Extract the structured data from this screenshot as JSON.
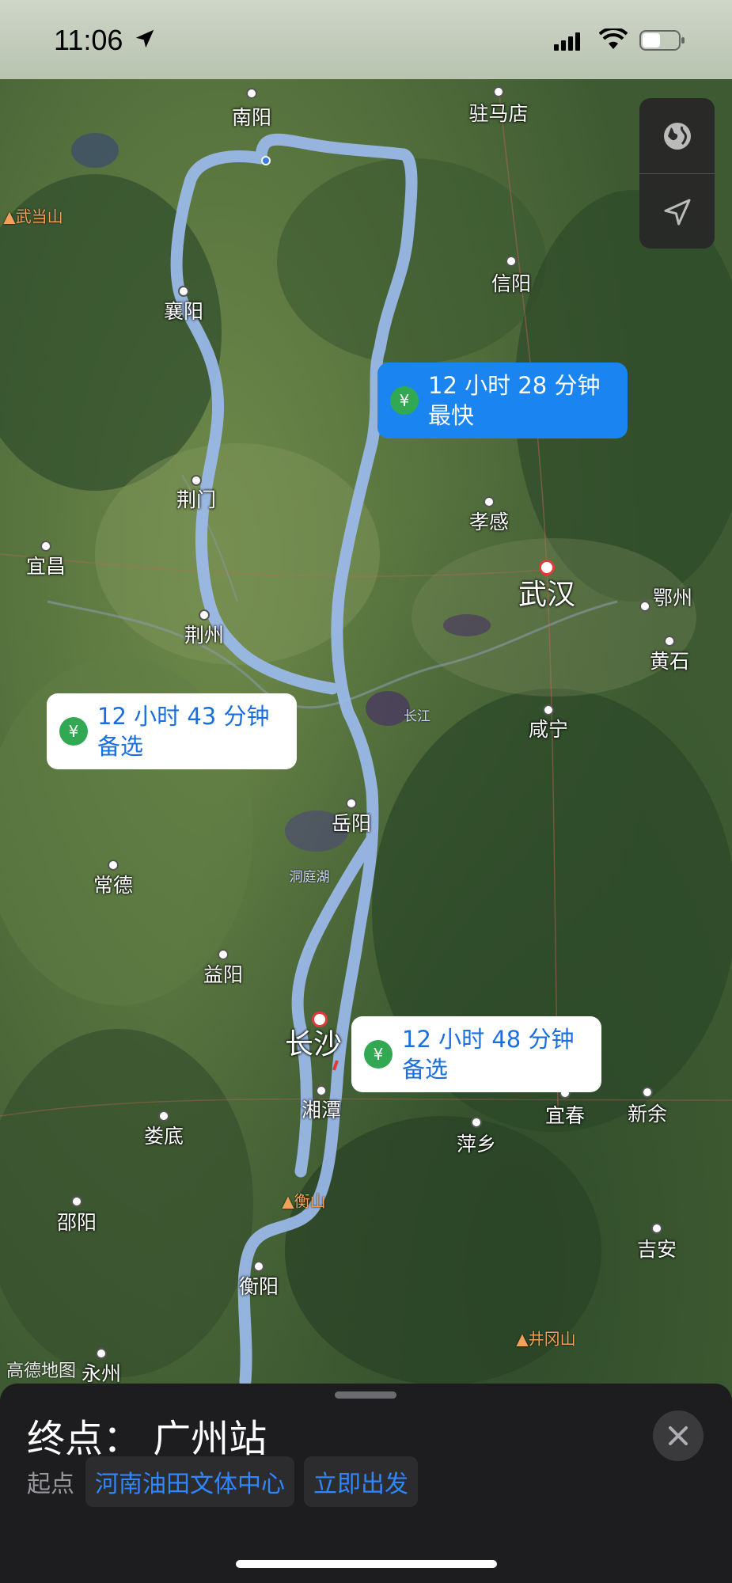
{
  "status_bar": {
    "time": "11:06"
  },
  "map": {
    "cities": [
      {
        "name": "南阳",
        "style": "normal"
      },
      {
        "name": "驻马店",
        "style": "normal"
      },
      {
        "name": "武当山",
        "style": "orange"
      },
      {
        "name": "信阳",
        "style": "normal"
      },
      {
        "name": "襄阳",
        "style": "normal"
      },
      {
        "name": "荆门",
        "style": "normal"
      },
      {
        "name": "孝感",
        "style": "normal"
      },
      {
        "name": "宜昌",
        "style": "normal"
      },
      {
        "name": "武汉",
        "style": "big"
      },
      {
        "name": "鄂州",
        "style": "normal"
      },
      {
        "name": "荆州",
        "style": "normal"
      },
      {
        "name": "黄石",
        "style": "normal"
      },
      {
        "name": "长江",
        "style": "small"
      },
      {
        "name": "咸宁",
        "style": "normal"
      },
      {
        "name": "岳阳",
        "style": "normal"
      },
      {
        "name": "洞庭湖",
        "style": "small"
      },
      {
        "name": "常德",
        "style": "normal"
      },
      {
        "name": "益阳",
        "style": "normal"
      },
      {
        "name": "长沙",
        "style": "big"
      },
      {
        "name": "湘潭",
        "style": "normal"
      },
      {
        "name": "宜春",
        "style": "normal"
      },
      {
        "name": "新余",
        "style": "normal"
      },
      {
        "name": "娄底",
        "style": "normal"
      },
      {
        "name": "萍乡",
        "style": "normal"
      },
      {
        "name": "衡山",
        "style": "orange"
      },
      {
        "name": "邵阳",
        "style": "normal"
      },
      {
        "name": "吉安",
        "style": "normal"
      },
      {
        "name": "衡阳",
        "style": "normal"
      },
      {
        "name": "井冈山",
        "style": "orange"
      },
      {
        "name": "永州",
        "style": "normal"
      }
    ],
    "attribution": "高德地图",
    "routes": [
      {
        "duration": "12 小时 28 分钟",
        "tag": "最快",
        "selected": true,
        "icon": "yen-icon"
      },
      {
        "duration": "12 小时 43 分钟",
        "tag": "备选",
        "selected": false,
        "icon": "yen-icon"
      },
      {
        "duration": "12 小时 48 分钟",
        "tag": "备选",
        "selected": false,
        "icon": "yen-icon"
      }
    ],
    "route_color": "#9dbcf0",
    "accent_color": "#1a84f0",
    "toll_icon_color": "#32a852"
  },
  "sheet": {
    "destination": "终点： 广州站",
    "start_label": "起点",
    "start_place": "河南油田文体中心",
    "depart": "立即出发"
  }
}
